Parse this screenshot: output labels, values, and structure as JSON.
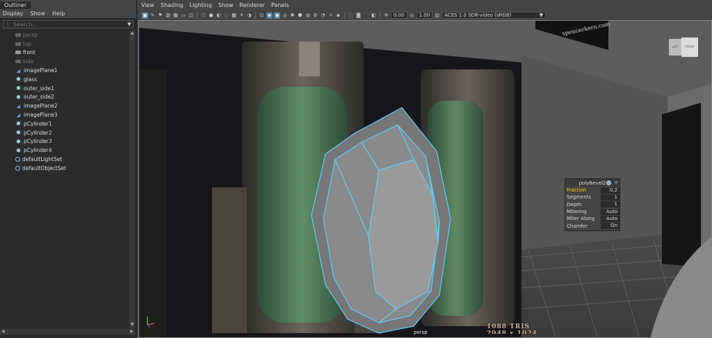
{
  "outliner": {
    "tab_label": "Outliner",
    "menu": [
      "Display",
      "Show",
      "Help"
    ],
    "search_placeholder": "Search...",
    "items": [
      {
        "label": "persp",
        "icon": "camera-icon",
        "dim": true
      },
      {
        "label": "top",
        "icon": "camera-icon",
        "dim": true
      },
      {
        "label": "front",
        "icon": "camera-icon",
        "dim": false
      },
      {
        "label": "side",
        "icon": "camera-icon",
        "dim": true
      },
      {
        "label": "imagePlane1",
        "icon": "image-plane-icon",
        "dim": false
      },
      {
        "label": "glass",
        "icon": "mesh-icon",
        "dim": false
      },
      {
        "label": "outer_side1",
        "icon": "mesh-icon",
        "dim": false
      },
      {
        "label": "outer_side2",
        "icon": "mesh-icon",
        "dim": false
      },
      {
        "label": "imagePlane2",
        "icon": "image-plane-icon",
        "dim": false
      },
      {
        "label": "imagePlane3",
        "icon": "image-plane-icon",
        "dim": false
      },
      {
        "label": "pCylinder1",
        "icon": "mesh-icon",
        "dim": false
      },
      {
        "label": "pCylinder2",
        "icon": "mesh-icon",
        "dim": false
      },
      {
        "label": "pCylinder3",
        "icon": "mesh-icon",
        "dim": false
      },
      {
        "label": "pCylinder4",
        "icon": "mesh-icon",
        "dim": false
      },
      {
        "label": "defaultLightSet",
        "icon": "set-icon",
        "dim": false
      },
      {
        "label": "defaultObjectSet",
        "icon": "set-icon",
        "dim": false
      }
    ]
  },
  "viewport": {
    "menu": [
      "View",
      "Shading",
      "Lighting",
      "Show",
      "Renderer",
      "Panels"
    ],
    "exposure": "0.00",
    "gamma": "1.00",
    "color_space": "ACES 1.0 SDR-video (sRGB)",
    "camera_label": "persp",
    "tris_text": "1088 TRIS",
    "texture_size_text": "2048 x 1024",
    "banner_text": "spencerkern.com",
    "viewcube": {
      "left": "LEFT",
      "front": "FRONT"
    }
  },
  "poly_bevel": {
    "title": "polyBevel2",
    "rows": [
      {
        "label": "Fraction",
        "value": "0.2",
        "selected": true
      },
      {
        "label": "Segments",
        "value": "1",
        "selected": false
      },
      {
        "label": "Depth",
        "value": "1",
        "selected": false
      },
      {
        "label": "Mitering",
        "value": "Auto",
        "selected": false
      },
      {
        "label": "Miter Along",
        "value": "Auto",
        "selected": false
      },
      {
        "label": "Chamfer",
        "value": "On",
        "selected": false
      }
    ]
  },
  "colors": {
    "selection_highlight": "#5fd0ff",
    "glass_green": "#5a8a5a",
    "active_attr": "#ffd700"
  }
}
